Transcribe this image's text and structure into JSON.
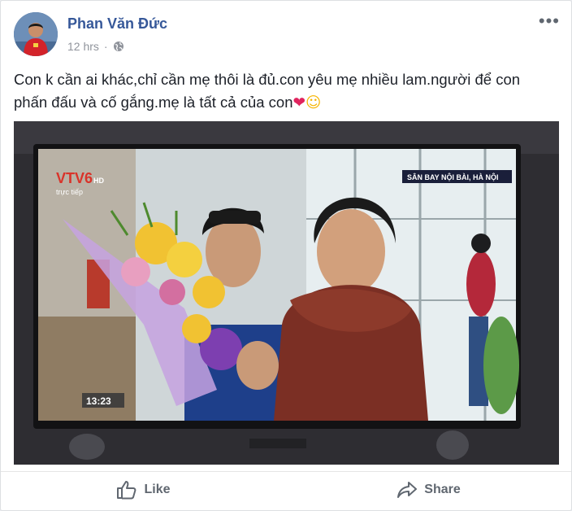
{
  "post": {
    "author": "Phan Văn Đức",
    "time": "12 hrs",
    "separator": "·",
    "more_label": "•••",
    "text": "Con k cần ai khác,chỉ cần mẹ thôi là đủ.con yêu mẹ nhiều lam.người để con phấn đấu và cố gắng.mẹ là tất cả của con",
    "emoji_heart": "❤",
    "emoji_smile": "☺",
    "icons": {
      "privacy": "globe-icon",
      "more": "more-options-icon"
    }
  },
  "photo": {
    "channel_logo": "VTV6",
    "channel_suffix": "HD",
    "live_label": "trực tiếp",
    "location_caption": "SÂN BAY NỘI BÀI, HÀ NỘI",
    "clock": "13:23"
  },
  "actions": {
    "like_label": "Like",
    "share_label": "Share",
    "icons": {
      "like": "thumbs-up-icon",
      "share": "share-arrow-icon"
    }
  },
  "colors": {
    "author_link": "#365899",
    "secondary_text": "#90949c",
    "action_text": "#606770",
    "heart": "#e0245e"
  }
}
